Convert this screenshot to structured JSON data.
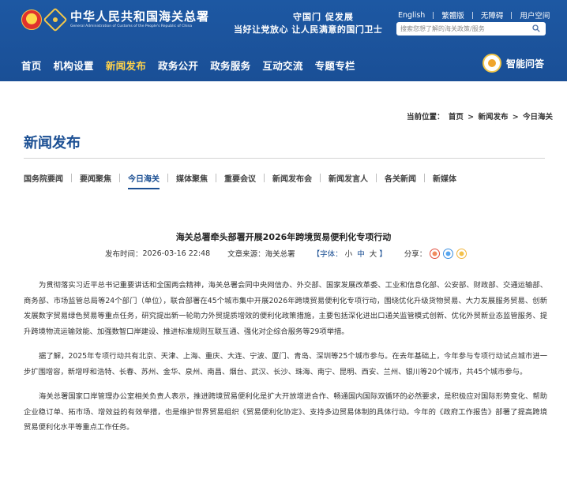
{
  "header": {
    "logo_cn": "中华人民共和国海关总署",
    "logo_en": "General Administration of Customs of the People's Republic of China",
    "slogan_line1": "守国门  促发展",
    "slogan_line2": "当好让党放心  让人民满意的国门卫士",
    "top_links": [
      "English",
      "繁體版",
      "无障碍",
      "用户空间"
    ],
    "search_placeholder": "搜索您想了解的海关政策/服务",
    "nav": [
      "首页",
      "机构设置",
      "新闻发布",
      "政务公开",
      "政务服务",
      "互动交流",
      "专题专栏"
    ],
    "nav_active": "新闻发布",
    "assistant_label": "智能问答"
  },
  "breadcrumb": {
    "prefix": "当前位置：",
    "items": [
      "首页",
      "新闻发布",
      "今日海关"
    ],
    "separator": ">"
  },
  "section_title": "新闻发布",
  "subnav": {
    "items": [
      "国务院要闻",
      "要闻聚焦",
      "今日海关",
      "媒体聚焦",
      "重要会议",
      "新闻发布会",
      "新闻发言人",
      "各关新闻",
      "新媒体"
    ],
    "active": "今日海关"
  },
  "article": {
    "title": "海关总署牵头部署开展2026年跨境贸易便利化专项行动",
    "publish_label": "发布时间：",
    "publish_time": "2026-03-16 22:48",
    "source_label": "文章来源：",
    "source": "海关总署",
    "font_label_open": "【字体：",
    "font_small": "小",
    "font_medium": "中",
    "font_large": "大",
    "font_label_close": "】",
    "share_label": "分享：",
    "share_icons": [
      "weibo-icon",
      "qq-icon",
      "qzone-icon"
    ],
    "paragraphs": [
      "为贯彻落实习近平总书记重要讲话和全国两会精神，海关总署会同中央网信办、外交部、国家发展改革委、工业和信息化部、公安部、财政部、交通运输部、商务部、市场监管总局等24个部门（单位），联合部署在45个城市集中开展2026年跨境贸易便利化专项行动，围绕优化升级货物贸易、大力发展服务贸易、创新发展数字贸易绿色贸易等重点任务，研究提出新一轮助力外贸提质增效的便利化政策措施，主要包括深化进出口通关监管模式创新、优化外贸新业态监管服务、提升跨境物流运输效能、加强数智口岸建设、推进标准规则互联互通、强化对企综合服务等29项举措。",
      "据了解，2025年专项行动共有北京、天津、上海、重庆、大连、宁波、厦门、青岛、深圳等25个城市参与。在去年基础上，今年参与专项行动试点城市进一步扩围增容，新增呼和浩特、长春、苏州、金华、泉州、南昌、烟台、武汉、长沙、珠海、南宁、昆明、西安、兰州、银川等20个城市，共45个城市参与。",
      "海关总署国家口岸管理办公室相关负责人表示，推进跨境贸易便利化是扩大开放增进合作、畅通国内国际双循环的必然要求，是积极应对国际形势变化、帮助企业稳订单、拓市场、增效益的有效举措，也是维护世界贸易组织《贸易便利化协定》、支持多边贸易体制的具体行动。今年的《政府工作报告》部署了提高跨境贸易便利化水平等重点工作任务。"
    ]
  }
}
